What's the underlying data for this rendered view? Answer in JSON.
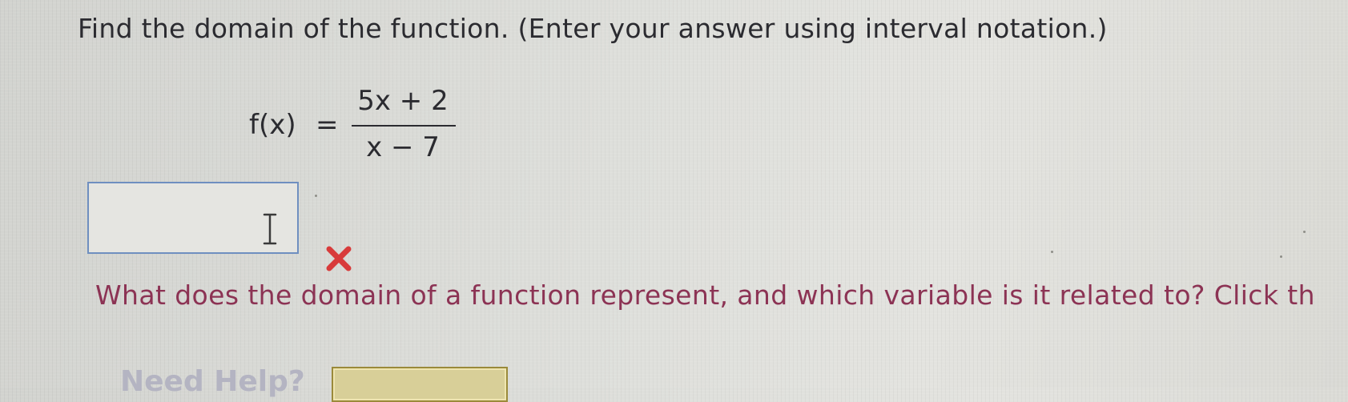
{
  "question": {
    "text": "Find the domain of the function. (Enter your answer using interval notation.)"
  },
  "equation": {
    "lhs": "f(x)",
    "equals": "=",
    "numerator": "5x + 2",
    "denominator": "x − 7"
  },
  "answer": {
    "value": "",
    "placeholder": ""
  },
  "feedback": {
    "status_icon": "red-x-icon",
    "incorrect_color": "#d83b3b",
    "hint_text": "What does the domain of a function represent, and which variable is it related to? Click th",
    "hint_color": "#8c3354"
  },
  "help": {
    "label": "Need Help?",
    "read_button_label": ""
  }
}
